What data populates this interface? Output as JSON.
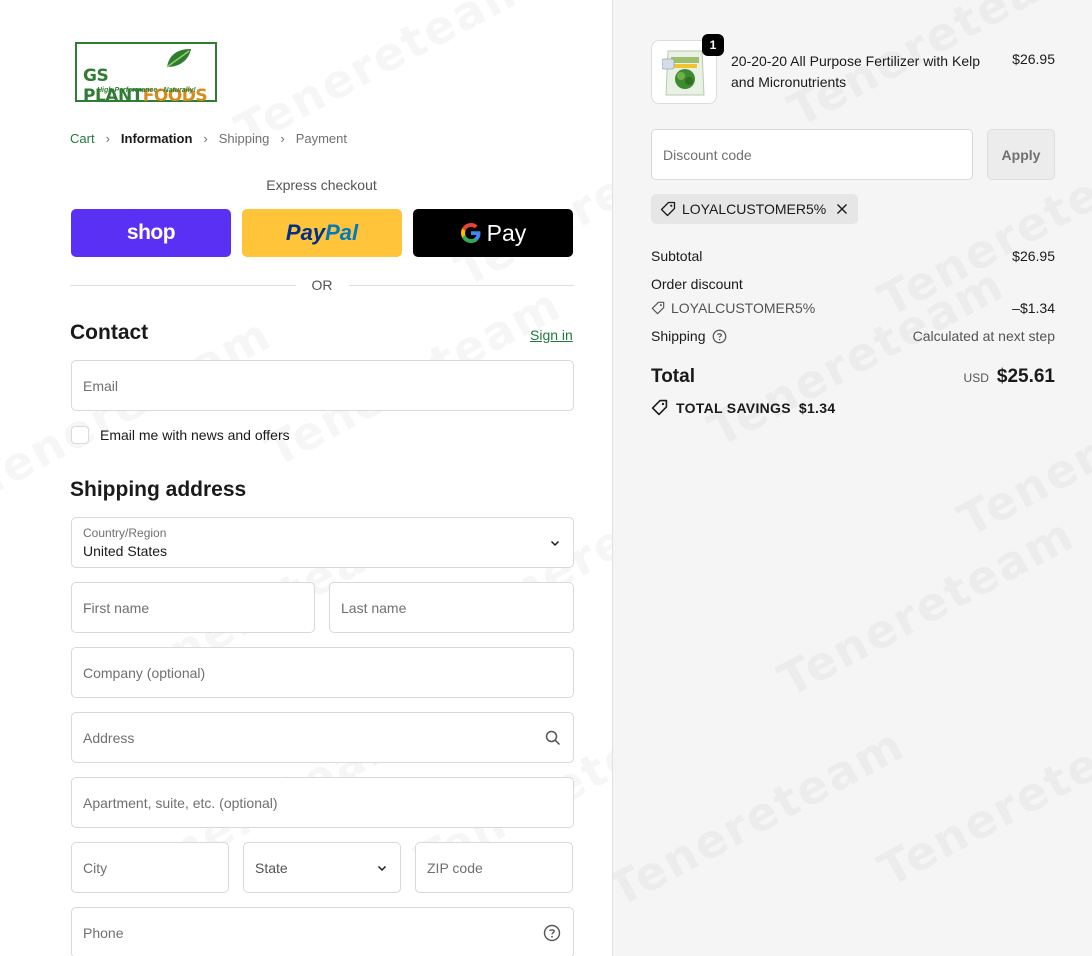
{
  "logo": {
    "name_part1": "GS PLANT",
    "name_part2": "FOODS",
    "tagline": "High Performance - Naturally!"
  },
  "breadcrumb": [
    {
      "label": "Cart"
    },
    {
      "label": "Information"
    },
    {
      "label": "Shipping"
    },
    {
      "label": "Payment"
    }
  ],
  "express": {
    "title": "Express checkout",
    "shop_label": "shop",
    "paypal_label_1": "Pay",
    "paypal_label_2": "Pal",
    "gpay_label": "Pay",
    "or_label": "OR"
  },
  "contact": {
    "heading": "Contact",
    "signin_label": "Sign in",
    "email_placeholder": "Email",
    "news_label": "Email me with news and offers"
  },
  "shipping": {
    "heading": "Shipping address",
    "country_label": "Country/Region",
    "country_value": "United States",
    "first_name": "First name",
    "last_name": "Last name",
    "company": "Company (optional)",
    "address": "Address",
    "apartment": "Apartment, suite, etc. (optional)",
    "city": "City",
    "state": "State",
    "zip": "ZIP code",
    "phone": "Phone"
  },
  "summary": {
    "product": {
      "name": "20-20-20 All Purpose Fertilizer with Kelp and Micronutrients",
      "price": "$26.95",
      "quantity": "1"
    },
    "discount_placeholder": "Discount code",
    "apply_label": "Apply",
    "applied_code": "LOYALCUSTOMER5%",
    "subtotal_label": "Subtotal",
    "subtotal_value": "$26.95",
    "order_discount_label": "Order discount",
    "discount_code": "LOYALCUSTOMER5%",
    "discount_value": "–$1.34",
    "shipping_label": "Shipping",
    "shipping_value": "Calculated at next step",
    "total_label": "Total",
    "currency": "USD",
    "total_value": "$25.61",
    "savings_label": "TOTAL SAVINGS",
    "savings_value": "$1.34"
  },
  "watermark": "Tenereteam"
}
